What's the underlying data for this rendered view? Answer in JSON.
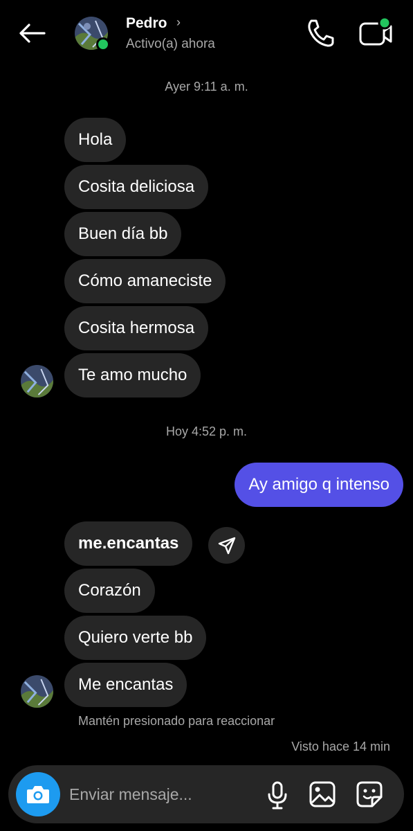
{
  "header": {
    "contact_name": "Pedro",
    "chevron": "›",
    "status": "Activo(a) ahora",
    "back_icon": "arrow-left-icon",
    "call_icon": "phone-icon",
    "video_icon": "video-call-icon",
    "online_color": "#22c55e"
  },
  "conversation": {
    "timestamp_1": "Ayer 9:11 a. m.",
    "received_group_1": [
      "Hola",
      "Cosita deliciosa",
      "Buen día bb",
      "Cómo amaneciste",
      "Cosita hermosa",
      "Te amo mucho"
    ],
    "timestamp_2": "Hoy 4:52 p. m.",
    "sent_message": "Ay amigo q intenso",
    "received_group_2": [
      "me.encantas",
      "Corazón",
      "Quiero verte bb",
      "Me encantas"
    ],
    "reaction_hint": "Mantén presionado para reaccionar",
    "seen_status": "Visto hace 14 min"
  },
  "composer": {
    "placeholder": "Enviar mensaje...",
    "camera_icon": "camera-icon",
    "mic_icon": "microphone-icon",
    "gallery_icon": "gallery-icon",
    "sticker_icon": "sticker-icon"
  },
  "colors": {
    "background": "#000000",
    "received_bubble": "#262626",
    "sent_bubble": "#5450e6",
    "camera_button": "#1d9bf0",
    "secondary_text": "#a8a8a8"
  }
}
